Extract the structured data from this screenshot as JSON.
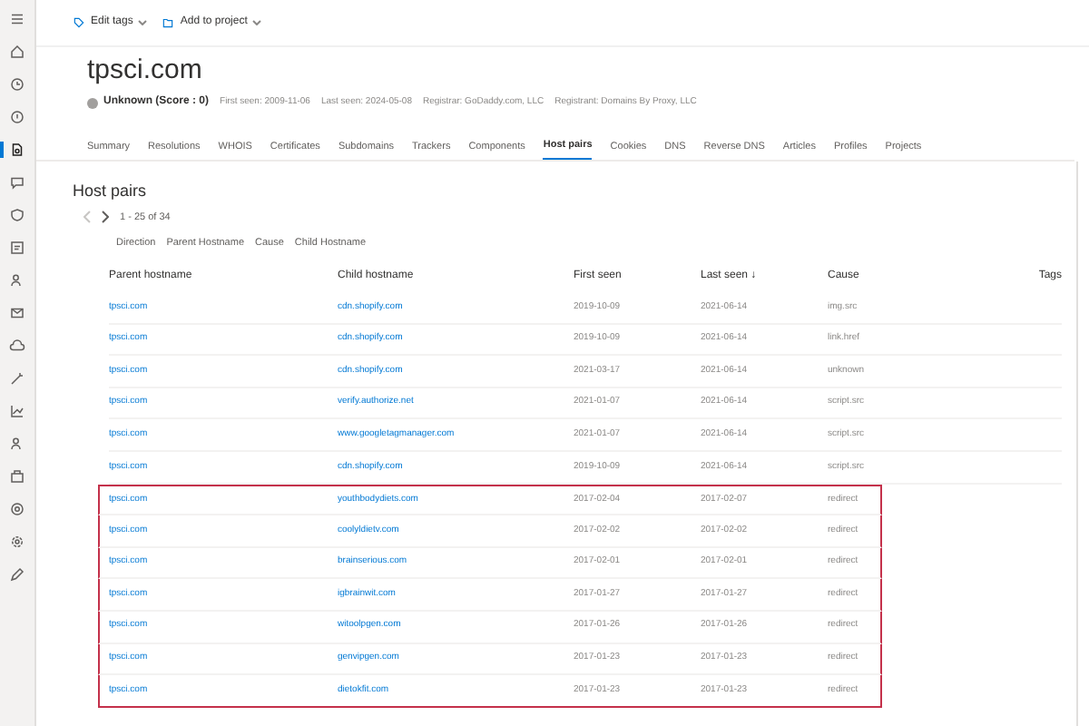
{
  "sidebar": {
    "items": [
      {
        "kind": "menu",
        "selected": false
      },
      {
        "kind": "home",
        "selected": false
      },
      {
        "kind": "clock",
        "selected": false
      },
      {
        "kind": "alert",
        "selected": false
      },
      {
        "kind": "doc",
        "selected": true
      },
      {
        "kind": "chat",
        "selected": false
      },
      {
        "kind": "shield",
        "selected": false
      },
      {
        "kind": "card",
        "selected": false
      },
      {
        "kind": "people",
        "selected": false
      },
      {
        "kind": "mail",
        "selected": false
      },
      {
        "kind": "cloud",
        "selected": false
      },
      {
        "kind": "wand",
        "selected": false
      },
      {
        "kind": "chart",
        "selected": false
      },
      {
        "kind": "people",
        "selected": false
      },
      {
        "kind": "box",
        "selected": false
      },
      {
        "kind": "target",
        "selected": false
      },
      {
        "kind": "gear",
        "selected": false
      },
      {
        "kind": "pen",
        "selected": false
      }
    ]
  },
  "toolbar": [
    {
      "kind": "tag",
      "label": "Edit tags"
    },
    {
      "kind": "folder",
      "label": "Add to project"
    }
  ],
  "title": "tpsci.com",
  "reputation": "Unknown (Score : 0)",
  "meta": [
    "First seen: 2009-11-06",
    "Last seen: 2024-05-08",
    "Registrar: GoDaddy.com, LLC",
    "Registrant: Domains By Proxy, LLC"
  ],
  "tabs": [
    {
      "label": "Summary",
      "selected": false
    },
    {
      "label": "Resolutions",
      "selected": false
    },
    {
      "label": "WHOIS",
      "selected": false
    },
    {
      "label": "Certificates",
      "selected": false
    },
    {
      "label": "Subdomains",
      "selected": false
    },
    {
      "label": "Trackers",
      "selected": false
    },
    {
      "label": "Components",
      "selected": false
    },
    {
      "label": "Host pairs",
      "selected": true
    },
    {
      "label": "Cookies",
      "selected": false
    },
    {
      "label": "DNS",
      "selected": false
    },
    {
      "label": "Reverse DNS",
      "selected": false
    },
    {
      "label": "Articles",
      "selected": false
    },
    {
      "label": "Profiles",
      "selected": false
    },
    {
      "label": "Projects",
      "selected": false
    }
  ],
  "section_title": "Host pairs",
  "pager": "1 - 25 of 34",
  "filters": [
    "Direction",
    "Parent Hostname",
    "Cause",
    "Child Hostname"
  ],
  "table": {
    "columns": [
      "Parent hostname",
      "Child hostname",
      "First seen",
      "Last seen ↓",
      "Cause",
      "Tags"
    ],
    "rows": [
      {
        "cells": [
          "tpsci.com",
          "cdn.shopify.com",
          "2019-10-09",
          "2021-06-14",
          "img.src"
        ],
        "highlighted": false
      },
      {
        "cells": [
          "tpsci.com",
          "cdn.shopify.com",
          "2019-10-09",
          "2021-06-14",
          "link.href"
        ],
        "highlighted": false
      },
      {
        "cells": [
          "tpsci.com",
          "cdn.shopify.com",
          "2021-03-17",
          "2021-06-14",
          "unknown"
        ],
        "highlighted": false
      },
      {
        "cells": [
          "tpsci.com",
          "verify.authorize.net",
          "2021-01-07",
          "2021-06-14",
          "script.src"
        ],
        "highlighted": false
      },
      {
        "cells": [
          "tpsci.com",
          "www.googletagmanager.com",
          "2021-01-07",
          "2021-06-14",
          "script.src"
        ],
        "highlighted": false
      },
      {
        "cells": [
          "tpsci.com",
          "cdn.shopify.com",
          "2019-10-09",
          "2021-06-14",
          "script.src"
        ],
        "highlighted": false
      },
      {
        "cells": [
          "tpsci.com",
          "youthbodydiets.com",
          "2017-02-04",
          "2017-02-07",
          "redirect"
        ],
        "highlighted": true
      },
      {
        "cells": [
          "tpsci.com",
          "coolyldietv.com",
          "2017-02-02",
          "2017-02-02",
          "redirect"
        ],
        "highlighted": true
      },
      {
        "cells": [
          "tpsci.com",
          "brainserious.com",
          "2017-02-01",
          "2017-02-01",
          "redirect"
        ],
        "highlighted": true
      },
      {
        "cells": [
          "tpsci.com",
          "igbrainwit.com",
          "2017-01-27",
          "2017-01-27",
          "redirect"
        ],
        "highlighted": true
      },
      {
        "cells": [
          "tpsci.com",
          "witoolpgen.com",
          "2017-01-26",
          "2017-01-26",
          "redirect"
        ],
        "highlighted": true
      },
      {
        "cells": [
          "tpsci.com",
          "genvipgen.com",
          "2017-01-23",
          "2017-01-23",
          "redirect"
        ],
        "highlighted": true
      },
      {
        "cells": [
          "tpsci.com",
          "dietokfit.com",
          "2017-01-23",
          "2017-01-23",
          "redirect"
        ],
        "highlighted": true
      }
    ]
  }
}
